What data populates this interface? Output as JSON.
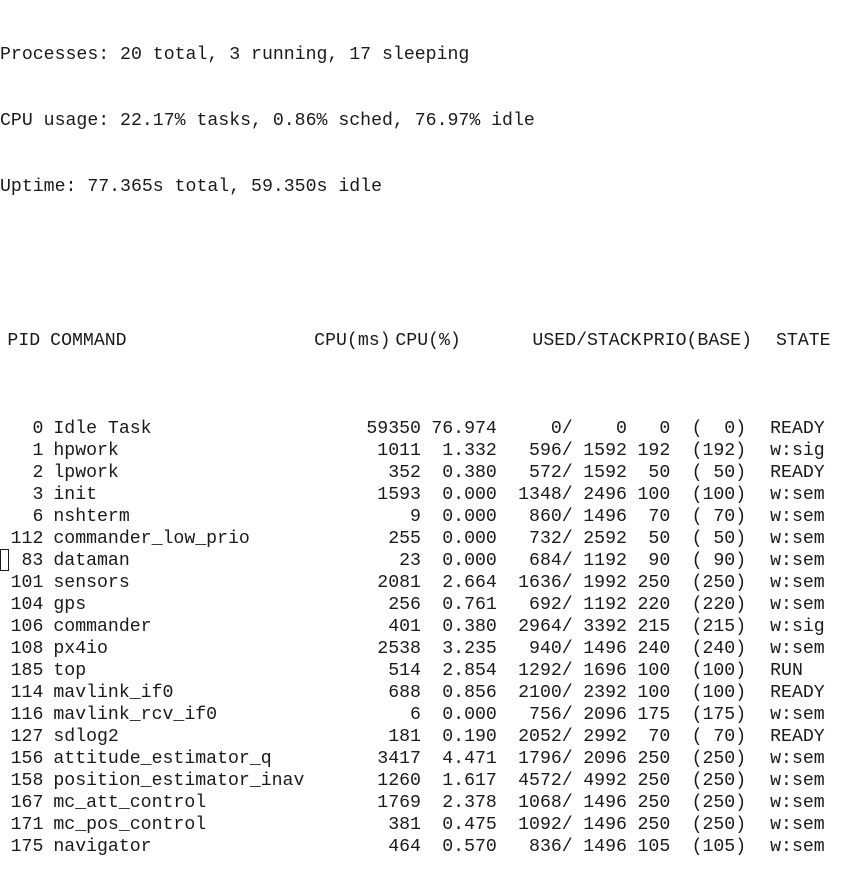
{
  "summary": {
    "processes": "Processes: 20 total, 3 running, 17 sleeping",
    "cpu": "CPU usage: 22.17% tasks, 0.86% sched, 76.97% idle",
    "uptime": "Uptime: 77.365s total, 59.350s idle"
  },
  "table": {
    "headers": {
      "pid": "PID",
      "command": "COMMAND",
      "cpu_ms": "CPU(ms)",
      "cpu_pct": "CPU(%)",
      "used_stack": "USED/STACK",
      "prio_base": "PRIO(BASE)",
      "state": "STATE"
    },
    "rows": [
      {
        "pid": "0",
        "command": "Idle Task",
        "cpu_ms": "59350",
        "cpu_pct": "76.974",
        "used": "0/",
        "stack": "0",
        "prio": "0",
        "base": "(  0)",
        "state": "READY"
      },
      {
        "pid": "1",
        "command": "hpwork",
        "cpu_ms": "1011",
        "cpu_pct": "1.332",
        "used": "596/",
        "stack": "1592",
        "prio": "192",
        "base": "(192)",
        "state": "w:sig"
      },
      {
        "pid": "2",
        "command": "lpwork",
        "cpu_ms": "352",
        "cpu_pct": "0.380",
        "used": "572/",
        "stack": "1592",
        "prio": "50",
        "base": "( 50)",
        "state": "READY"
      },
      {
        "pid": "3",
        "command": "init",
        "cpu_ms": "1593",
        "cpu_pct": "0.000",
        "used": "1348/",
        "stack": "2496",
        "prio": "100",
        "base": "(100)",
        "state": "w:sem"
      },
      {
        "pid": "6",
        "command": "nshterm",
        "cpu_ms": "9",
        "cpu_pct": "0.000",
        "used": "860/",
        "stack": "1496",
        "prio": "70",
        "base": "( 70)",
        "state": "w:sem"
      },
      {
        "pid": "112",
        "command": "commander_low_prio",
        "cpu_ms": "255",
        "cpu_pct": "0.000",
        "used": "732/",
        "stack": "2592",
        "prio": "50",
        "base": "( 50)",
        "state": "w:sem"
      },
      {
        "pid": "83",
        "command": "dataman",
        "cpu_ms": "23",
        "cpu_pct": "0.000",
        "used": "684/",
        "stack": "1192",
        "prio": "90",
        "base": "( 90)",
        "state": "w:sem"
      },
      {
        "pid": "101",
        "command": "sensors",
        "cpu_ms": "2081",
        "cpu_pct": "2.664",
        "used": "1636/",
        "stack": "1992",
        "prio": "250",
        "base": "(250)",
        "state": "w:sem"
      },
      {
        "pid": "104",
        "command": "gps",
        "cpu_ms": "256",
        "cpu_pct": "0.761",
        "used": "692/",
        "stack": "1192",
        "prio": "220",
        "base": "(220)",
        "state": "w:sem"
      },
      {
        "pid": "106",
        "command": "commander",
        "cpu_ms": "401",
        "cpu_pct": "0.380",
        "used": "2964/",
        "stack": "3392",
        "prio": "215",
        "base": "(215)",
        "state": "w:sig"
      },
      {
        "pid": "108",
        "command": "px4io",
        "cpu_ms": "2538",
        "cpu_pct": "3.235",
        "used": "940/",
        "stack": "1496",
        "prio": "240",
        "base": "(240)",
        "state": "w:sem"
      },
      {
        "pid": "185",
        "command": "top",
        "cpu_ms": "514",
        "cpu_pct": "2.854",
        "used": "1292/",
        "stack": "1696",
        "prio": "100",
        "base": "(100)",
        "state": "RUN"
      },
      {
        "pid": "114",
        "command": "mavlink_if0",
        "cpu_ms": "688",
        "cpu_pct": "0.856",
        "used": "2100/",
        "stack": "2392",
        "prio": "100",
        "base": "(100)",
        "state": "READY"
      },
      {
        "pid": "116",
        "command": "mavlink_rcv_if0",
        "cpu_ms": "6",
        "cpu_pct": "0.000",
        "used": "756/",
        "stack": "2096",
        "prio": "175",
        "base": "(175)",
        "state": "w:sem"
      },
      {
        "pid": "127",
        "command": "sdlog2",
        "cpu_ms": "181",
        "cpu_pct": "0.190",
        "used": "2052/",
        "stack": "2992",
        "prio": "70",
        "base": "( 70)",
        "state": "READY"
      },
      {
        "pid": "156",
        "command": "attitude_estimator_q",
        "cpu_ms": "3417",
        "cpu_pct": "4.471",
        "used": "1796/",
        "stack": "2096",
        "prio": "250",
        "base": "(250)",
        "state": "w:sem"
      },
      {
        "pid": "158",
        "command": "position_estimator_inav",
        "cpu_ms": "1260",
        "cpu_pct": "1.617",
        "used": "4572/",
        "stack": "4992",
        "prio": "250",
        "base": "(250)",
        "state": "w:sem"
      },
      {
        "pid": "167",
        "command": "mc_att_control",
        "cpu_ms": "1769",
        "cpu_pct": "2.378",
        "used": "1068/",
        "stack": "1496",
        "prio": "250",
        "base": "(250)",
        "state": "w:sem"
      },
      {
        "pid": "171",
        "command": "mc_pos_control",
        "cpu_ms": "381",
        "cpu_pct": "0.475",
        "used": "1092/",
        "stack": "1496",
        "prio": "250",
        "base": "(250)",
        "state": "w:sem"
      },
      {
        "pid": "175",
        "command": "navigator",
        "cpu_ms": "464",
        "cpu_pct": "0.570",
        "used": "836/",
        "stack": "1496",
        "prio": "105",
        "base": "(105)",
        "state": "w:sem"
      }
    ]
  }
}
